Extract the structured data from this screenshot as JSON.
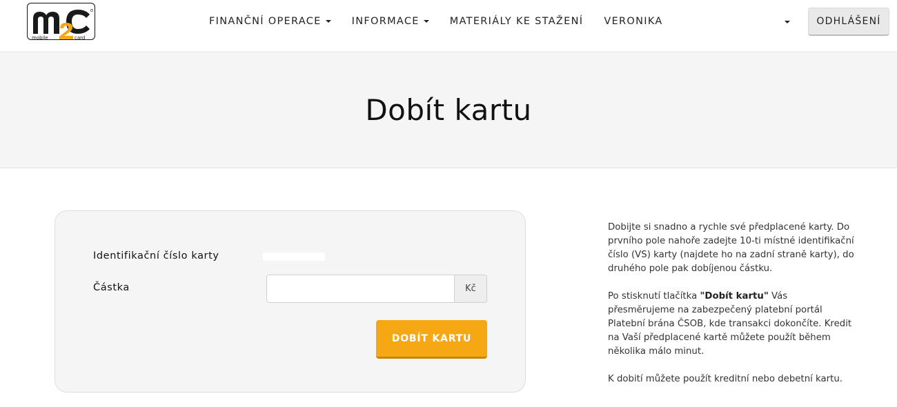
{
  "brand": {
    "logo_text": "m2c",
    "logo_subtext": "mobile card",
    "logo_dark": "#1a1a1a",
    "logo_accent": "#f5a813"
  },
  "nav": {
    "items": [
      {
        "label": "FINANČNÍ OPERACE",
        "has_dropdown": true
      },
      {
        "label": "INFORMACE",
        "has_dropdown": true
      },
      {
        "label": "MATERIÁLY KE STAŽENÍ",
        "has_dropdown": false
      },
      {
        "label": "VERONIKA",
        "has_dropdown": false
      }
    ],
    "logout_label": "ODHLÁŠENÍ"
  },
  "hero": {
    "title": "Dobít kartu"
  },
  "form": {
    "card_id_label": "Identifikační číslo karty",
    "card_id_value": "",
    "amount_label": "Částka",
    "amount_value": "",
    "currency": "Kč",
    "submit_label": "DOBÍT KARTU"
  },
  "info": {
    "p1": "Dobijte si snadno a rychle své předplacené karty. Do prvního pole nahoře zadejte 10-ti místné identifikační číslo (VS) karty (najdete ho na zadní straně karty), do druhého pole pak dobíjenou částku.",
    "p2_prefix": "Po stisknutí tlačítka ",
    "p2_bold": "\"Dobít kartu\"",
    "p2_suffix": " Vás přesměrujeme na zabezpečený platební portál Platební brána ČSOB, kde transakci dokončíte. Kredit na Vaší předplacené kartě můžete použít během několika málo minut.",
    "p3": "K dobití můžete použít kreditní nebo debetní kartu."
  },
  "colors": {
    "accent": "#f5a813",
    "hero_bg": "#f5f5f5",
    "card_bg": "#f5f5f5",
    "logout_bg": "#e9e9e9"
  }
}
